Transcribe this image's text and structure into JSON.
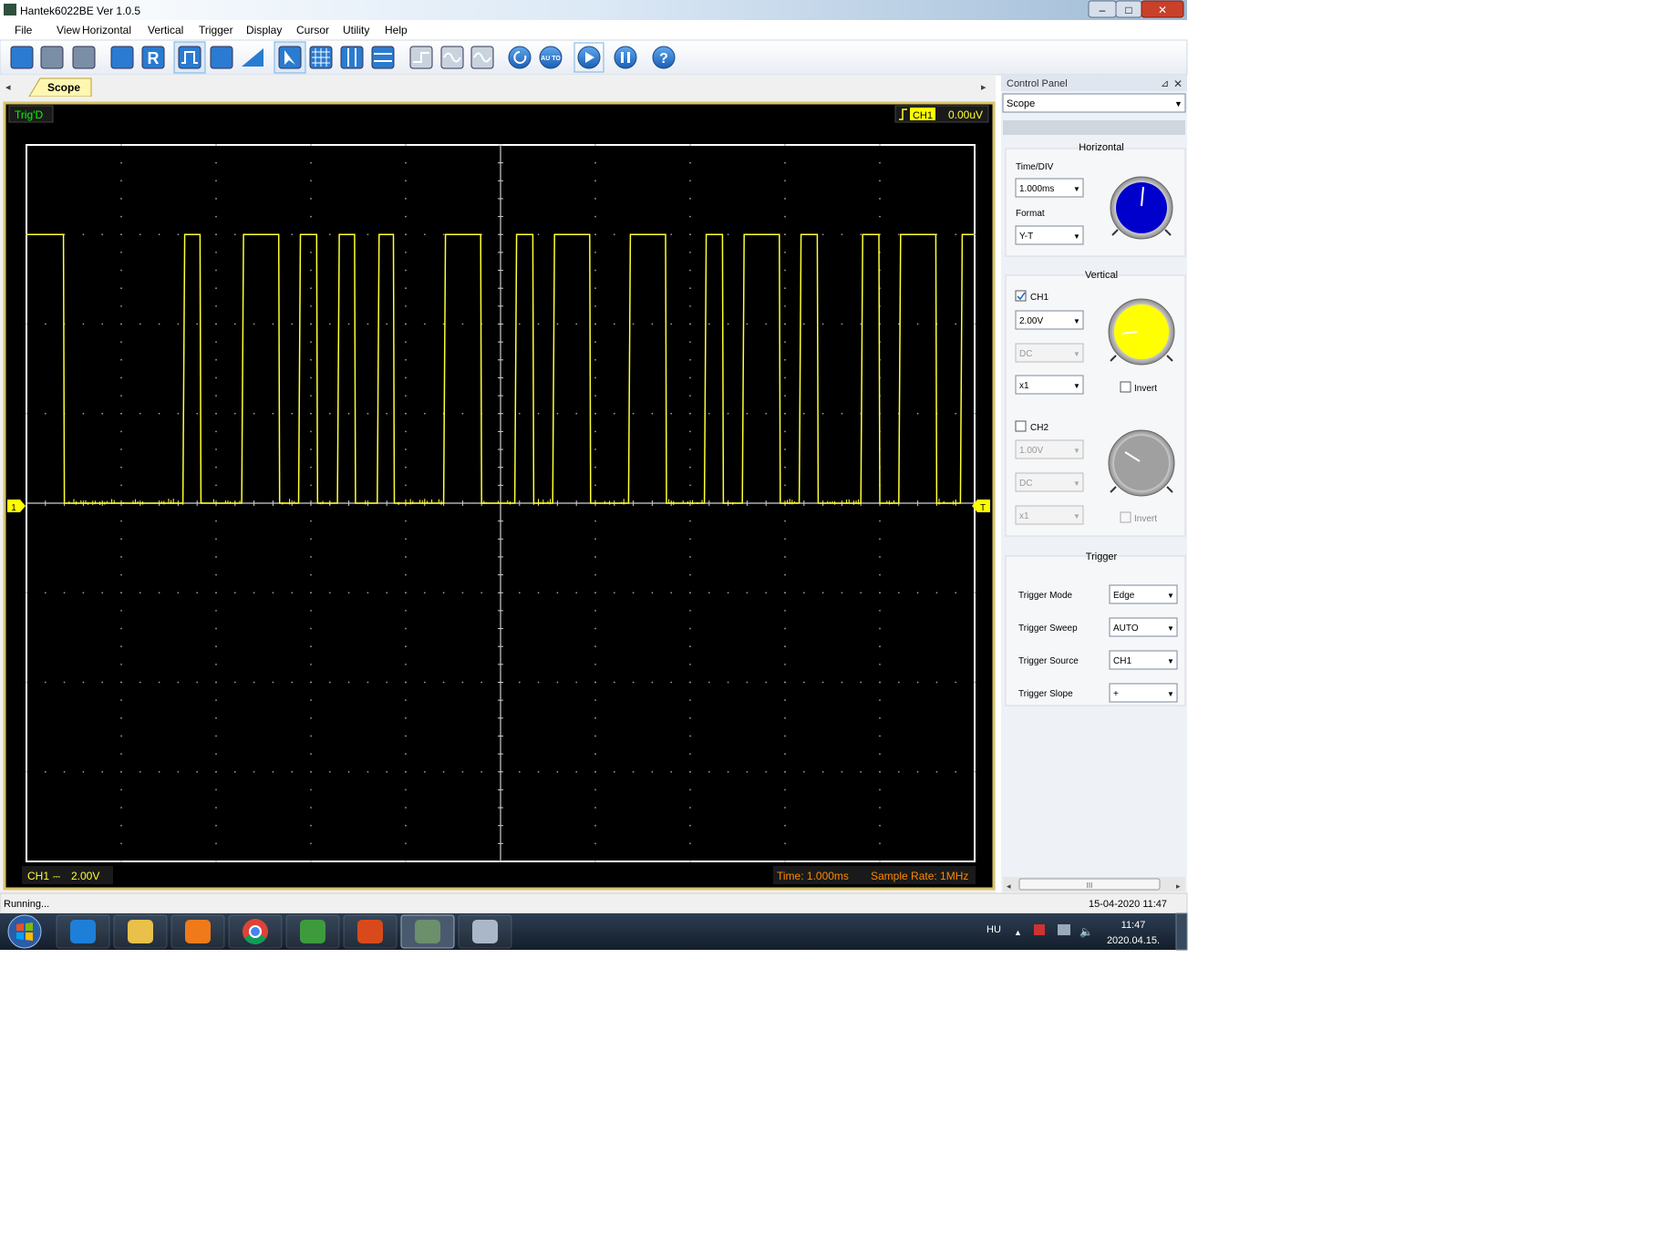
{
  "window": {
    "title": "Hantek6022BE Ver 1.0.5",
    "controls": [
      "–",
      "□",
      "✕"
    ]
  },
  "menu": [
    "File",
    "View",
    "Horizontal",
    "Vertical",
    "Trigger",
    "Display",
    "Cursor",
    "Utility",
    "Help"
  ],
  "toolbar": {
    "icons": [
      "load-icon",
      "save-icon",
      "print-icon",
      "autoset-icon",
      "r-icon",
      "pulse-icon",
      "persist-icon",
      "triangle-icon",
      "cursor-arrow-icon",
      "grid-icon",
      "vertical-cursor-icon",
      "horizontal-cursor-icon",
      "step-icon",
      "wave-icon",
      "sine-icon",
      "refresh-icon",
      "auto-icon",
      "run-icon",
      "pause-icon",
      "help-icon"
    ],
    "auto_label": "AU TO",
    "help_label": "?"
  },
  "tabs": {
    "active": "Scope"
  },
  "scope": {
    "trig_status": "Trig'D",
    "trigger_channel": "CH1",
    "trigger_level": "0.00uV",
    "ch1_marker": "1",
    "trigger_marker": "T",
    "footer_ch": "CH1",
    "footer_volts": "2.00V",
    "footer_time": "Time: 1.000ms",
    "footer_rate": "Sample Rate: 1MHz"
  },
  "signal": {
    "high_level_div": 3,
    "baseline_div": 0,
    "screen_duration_div": 10,
    "pulses_div": [
      [
        0.0,
        0.4
      ],
      [
        1.65,
        1.84
      ],
      [
        2.27,
        2.67
      ],
      [
        2.87,
        3.07
      ],
      [
        3.28,
        3.47
      ],
      [
        3.7,
        3.88
      ],
      [
        4.4,
        4.8
      ],
      [
        5.15,
        5.35
      ],
      [
        5.55,
        5.95
      ],
      [
        6.35,
        6.75
      ],
      [
        7.15,
        7.35
      ],
      [
        7.55,
        7.95
      ],
      [
        8.15,
        8.35
      ],
      [
        8.8,
        9.0
      ],
      [
        9.2,
        9.6
      ],
      [
        9.85,
        10.0
      ]
    ],
    "color": "#ffff33"
  },
  "control_panel": {
    "title": "Control Panel",
    "selector": "Scope",
    "horizontal": {
      "title": "Horizontal",
      "time_div_label": "Time/DIV",
      "time_div_value": "1.000ms",
      "format_label": "Format",
      "format_value": "Y-T",
      "knob_color": "#0000cc"
    },
    "vertical": {
      "title": "Vertical",
      "ch1": {
        "label": "CH1",
        "checked": true,
        "volts": "2.00V",
        "coupling": "DC",
        "probe": "x1",
        "invert_label": "Invert",
        "knob_color": "#ffff00"
      },
      "ch2": {
        "label": "CH2",
        "checked": false,
        "volts": "1.00V",
        "coupling": "DC",
        "probe": "x1",
        "invert_label": "Invert",
        "knob_color": "#a0a0a0"
      }
    },
    "trigger": {
      "title": "Trigger",
      "rows": [
        {
          "label": "Trigger Mode",
          "value": "Edge"
        },
        {
          "label": "Trigger Sweep",
          "value": "AUTO"
        },
        {
          "label": "Trigger Source",
          "value": "CH1"
        },
        {
          "label": "Trigger Slope",
          "value": "+"
        }
      ]
    },
    "scroll_thumb": "III"
  },
  "status_bar": {
    "status": "Running...",
    "datetime": "15-04-2020  11:47"
  },
  "taskbar": {
    "apps": [
      "ie-icon",
      "explorer-icon",
      "media-player-icon",
      "chrome-icon",
      "utorrent-icon",
      "office-icon",
      "hantek-icon",
      "paint-icon"
    ],
    "lang": "HU",
    "time": "11:47",
    "date": "2020.04.15."
  },
  "colors": {
    "trace": "#ffff33",
    "screen_bg": "#000000",
    "frame": "#d8c36a",
    "taskbar": "#1d2a3a",
    "label_green": "#00ff00",
    "footer_orange": "#ff8800"
  }
}
